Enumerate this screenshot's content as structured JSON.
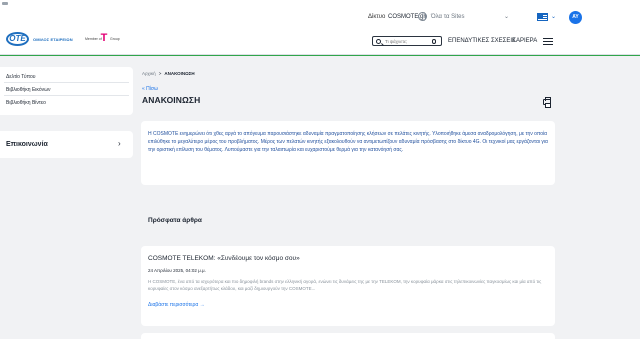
{
  "header": {
    "network_label": "Δίκτυο",
    "network_link": "COSMOTE.gr",
    "sites_select": "Όλα τα Sites",
    "language_chevron": "⌄",
    "user_initials": "AY",
    "logo_text": "OTE",
    "company_name": "ΟΜΙΛΟΣ ΕΤΑΙΡΕΙΩΝ",
    "dt_prefix": "Member of",
    "dt_logo": "T",
    "dt_suffix": "Group",
    "search_placeholder": "Τι ψάχνετε;",
    "nav_investor": "ΕΠΕΝΔΥΤΙΚΕΣ ΣΧΕΣΕΙΣ",
    "nav_careers": "ΚΑΡΙΕΡΑ"
  },
  "sidebar": {
    "items": [
      {
        "label": "Δελτίο Τύπου"
      },
      {
        "label": "Βιβλιοθήκη Εικόνων"
      },
      {
        "label": "Βιβλιοθήκη Βίντεο"
      }
    ],
    "contact_label": "Επικοινωνία"
  },
  "main": {
    "breadcrumb": {
      "home": "Αρχική",
      "separator": ">",
      "current": "ΑΝΑΚΟΙΝΩΣΗ"
    },
    "back_link": "« Πίσω",
    "title": "ΑΝΑΚΟΙΝΩΣΗ",
    "announcement": "Η COSMOTE ενημερώνει ότι χθες αργά το απόγευμα παρουσιάστηκε αδυναμία πραγματοποίησης κλήσεων σε πελάτες κινητής. Υλοποιήθηκε άμεσα αναδρομολόγηση, με την οποία επιλύθηκε το μεγαλύτερο μέρος του προβλήματος. Μέρος των πελατών κινητής εξακολουθούν να αντιμετωπίζουν αδυναμία πρόσβασης στο δίκτυο 4G. Οι τεχνικοί μας εργάζονται για την οριστική επίλυση του θέματος. Λυπούμαστε για την ταλαιπωρία και ευχαριστούμε θερμά για την κατανόησή σας.",
    "recent_heading": "Πρόσφατα άρθρα",
    "article": {
      "title": "COSMOTE TELEKOM: «Συνδέουμε τον κόσμο σου»",
      "date": "24 Απριλίου 2025, 04:02 μ.μ.",
      "excerpt": "Η COSMOTE, ένα από τα ισχυρότερα και πιο δημοφιλή brands στην ελληνική αγορά, ενώνει τις δυνάμεις της με την TELEKOM, την κορυφαία μάρκα στις τηλεπικοινωνίες παγκοσμίως και μία από τις κορυφαίες στον κόσμο ανεξαρτήτως κλάδου, και μαζί δημιουργούν την COSMOTE...",
      "read_more": "Διαβάστε περισσότερα →"
    }
  },
  "colors": {
    "accent_blue": "#1a73e8",
    "brand_blue": "#1f6fbf",
    "telekom_magenta": "#e20074",
    "header_line_green": "#30a64a",
    "page_background": "#f1f2f4"
  }
}
